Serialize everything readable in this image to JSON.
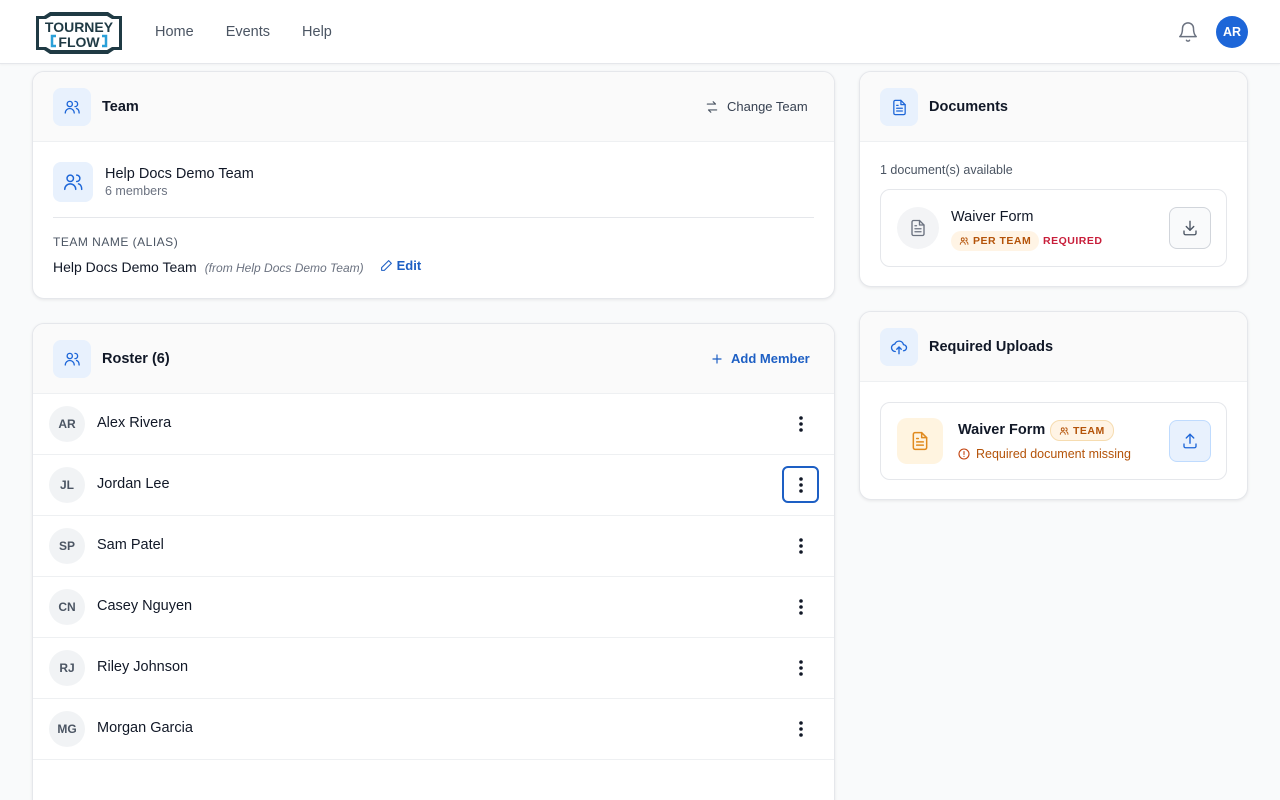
{
  "header": {
    "logo_text_top": "TOURNEY",
    "logo_text_bottom": "FLOW",
    "nav": [
      "Home",
      "Events",
      "Help"
    ],
    "user_initials": "AR",
    "accent_color": "#1d66d8"
  },
  "team": {
    "title": "Team",
    "change_label": "Change Team",
    "name": "Help Docs Demo Team",
    "members": "6 members",
    "alias_label": "TEAM NAME (ALIAS)",
    "alias_value": "Help Docs Demo Team",
    "alias_from": "(from Help Docs Demo Team)",
    "edit_label": "Edit"
  },
  "roster": {
    "title": "Roster (6)",
    "add_label": "Add Member",
    "members": [
      {
        "initials": "AR",
        "name": "Alex Rivera"
      },
      {
        "initials": "JL",
        "name": "Jordan Lee"
      },
      {
        "initials": "SP",
        "name": "Sam Patel"
      },
      {
        "initials": "CN",
        "name": "Casey Nguyen"
      },
      {
        "initials": "RJ",
        "name": "Riley Johnson"
      },
      {
        "initials": "MG",
        "name": "Morgan Garcia"
      }
    ]
  },
  "documents": {
    "title": "Documents",
    "count_text": "1 document(s) available",
    "items": [
      {
        "name": "Waiver Form",
        "scope": "PER TEAM",
        "status": "REQUIRED"
      }
    ]
  },
  "uploads": {
    "title": "Required Uploads",
    "items": [
      {
        "name": "Waiver Form",
        "scope": "TEAM",
        "status": "Required document missing"
      }
    ]
  }
}
